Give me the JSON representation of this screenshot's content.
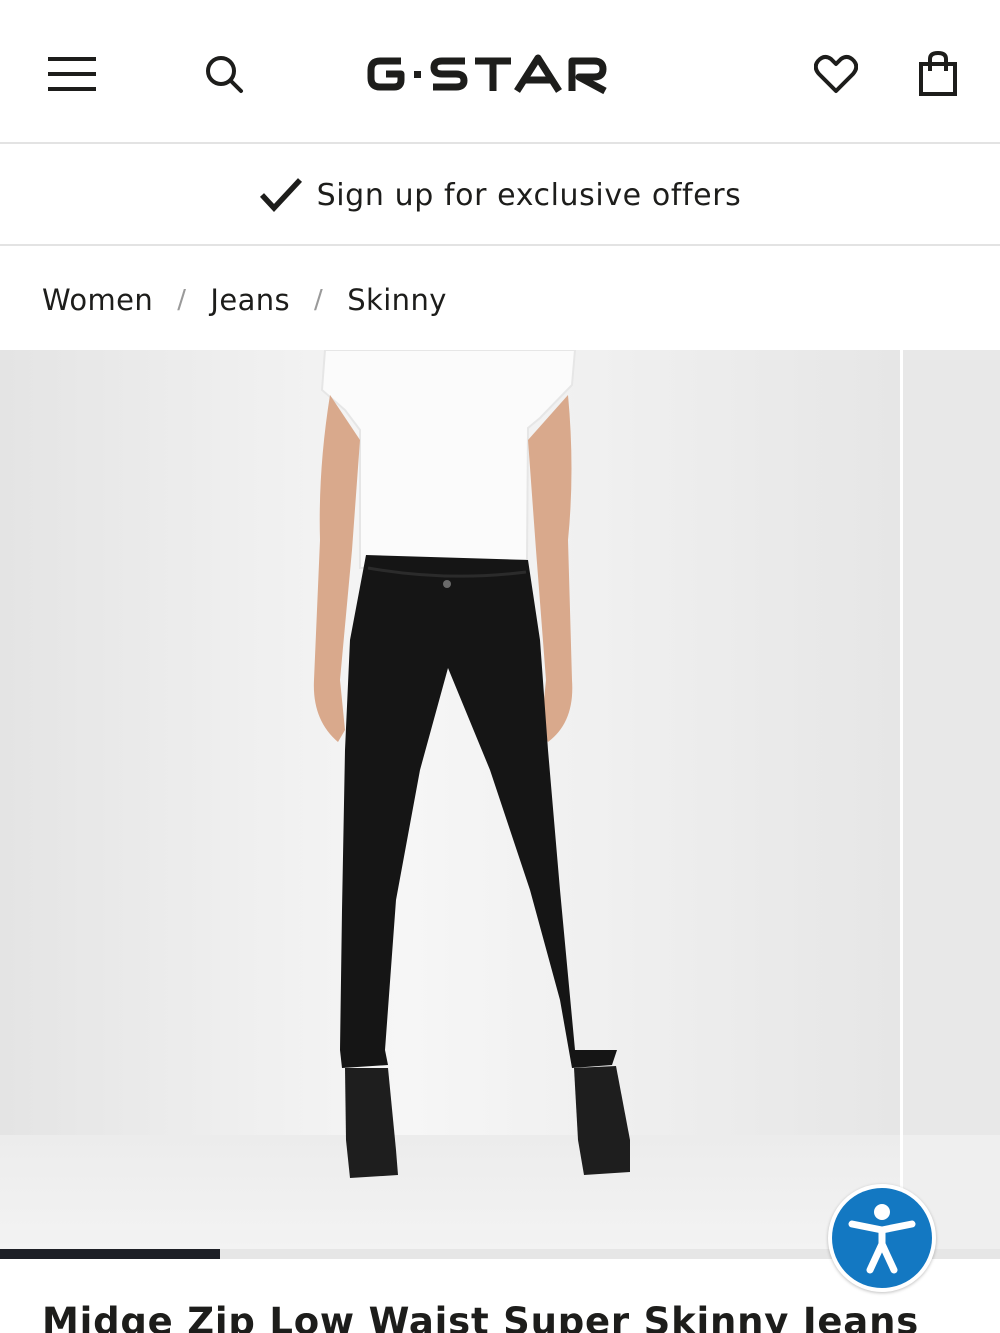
{
  "header": {
    "brand": "G-STAR",
    "icons": [
      "menu-icon",
      "search-icon",
      "heart-icon",
      "shopping-bag-icon"
    ]
  },
  "promo": {
    "text": "Sign up for exclusive offers",
    "icon": "checkmark-icon"
  },
  "breadcrumb": {
    "items": [
      "Women",
      "Jeans",
      "Skinny"
    ],
    "separator": "/"
  },
  "gallery": {
    "current_image": 1,
    "progress_fraction": 0.22,
    "accessibility_icon": "accessibility-icon",
    "accessibility_color": "#1378c2"
  },
  "product": {
    "title": "Midge Zip Low Waist Super Skinny Jeans"
  },
  "colors": {
    "text": "#1d1d1b",
    "divider": "#e3e3e3",
    "progress": "#1d1f26"
  }
}
